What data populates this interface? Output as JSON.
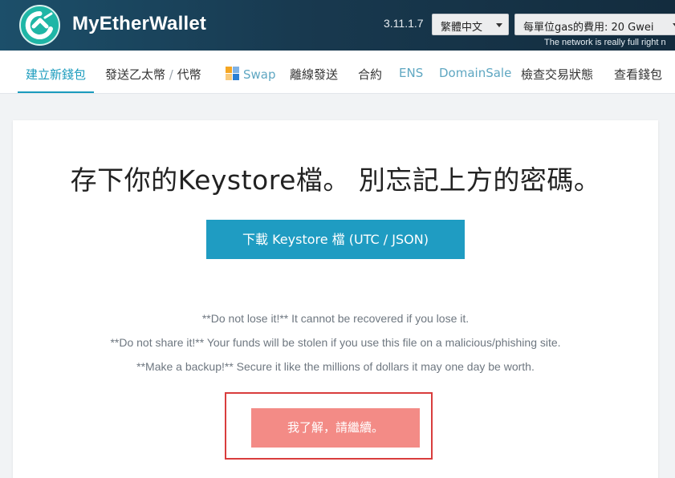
{
  "header": {
    "brand": "MyEtherWallet",
    "version": "3.11.1.7",
    "language_selected": "繁體中文",
    "gas_selected": "每單位gas的費用: 20 Gwei",
    "network_note": "The network is really full right n"
  },
  "nav": {
    "items": [
      {
        "label": "建立新錢包"
      },
      {
        "label": "發送乙太幣"
      },
      {
        "label": "/"
      },
      {
        "label": "代幣"
      },
      {
        "label": "Swap"
      },
      {
        "label": "離線發送"
      },
      {
        "label": "合約"
      },
      {
        "label": "ENS"
      },
      {
        "label": "DomainSale"
      },
      {
        "label": "檢查交易狀態"
      },
      {
        "label": "查看錢包"
      }
    ]
  },
  "main": {
    "title": "存下你的Keystore檔。 別忘記上方的密碼。",
    "download_button": "下載 Keystore 檔 (UTC / JSON)",
    "warnings": [
      "**Do not lose it!** It cannot be recovered if you lose it.",
      "**Do not share it!** Your funds will be stolen if you use this file on a malicious/phishing site.",
      "**Make a backup!** Secure it like the millions of dollars it may one day be worth."
    ],
    "continue_button": "我了解，請繼續。"
  },
  "colors": {
    "header_bg": "#18394f",
    "accent": "#1f9cc2",
    "continue_button": "#f38b86",
    "highlight_border": "#d93d3d"
  },
  "icons": [
    "mew-logo-icon",
    "chevron-down-icon",
    "swap-icon"
  ]
}
